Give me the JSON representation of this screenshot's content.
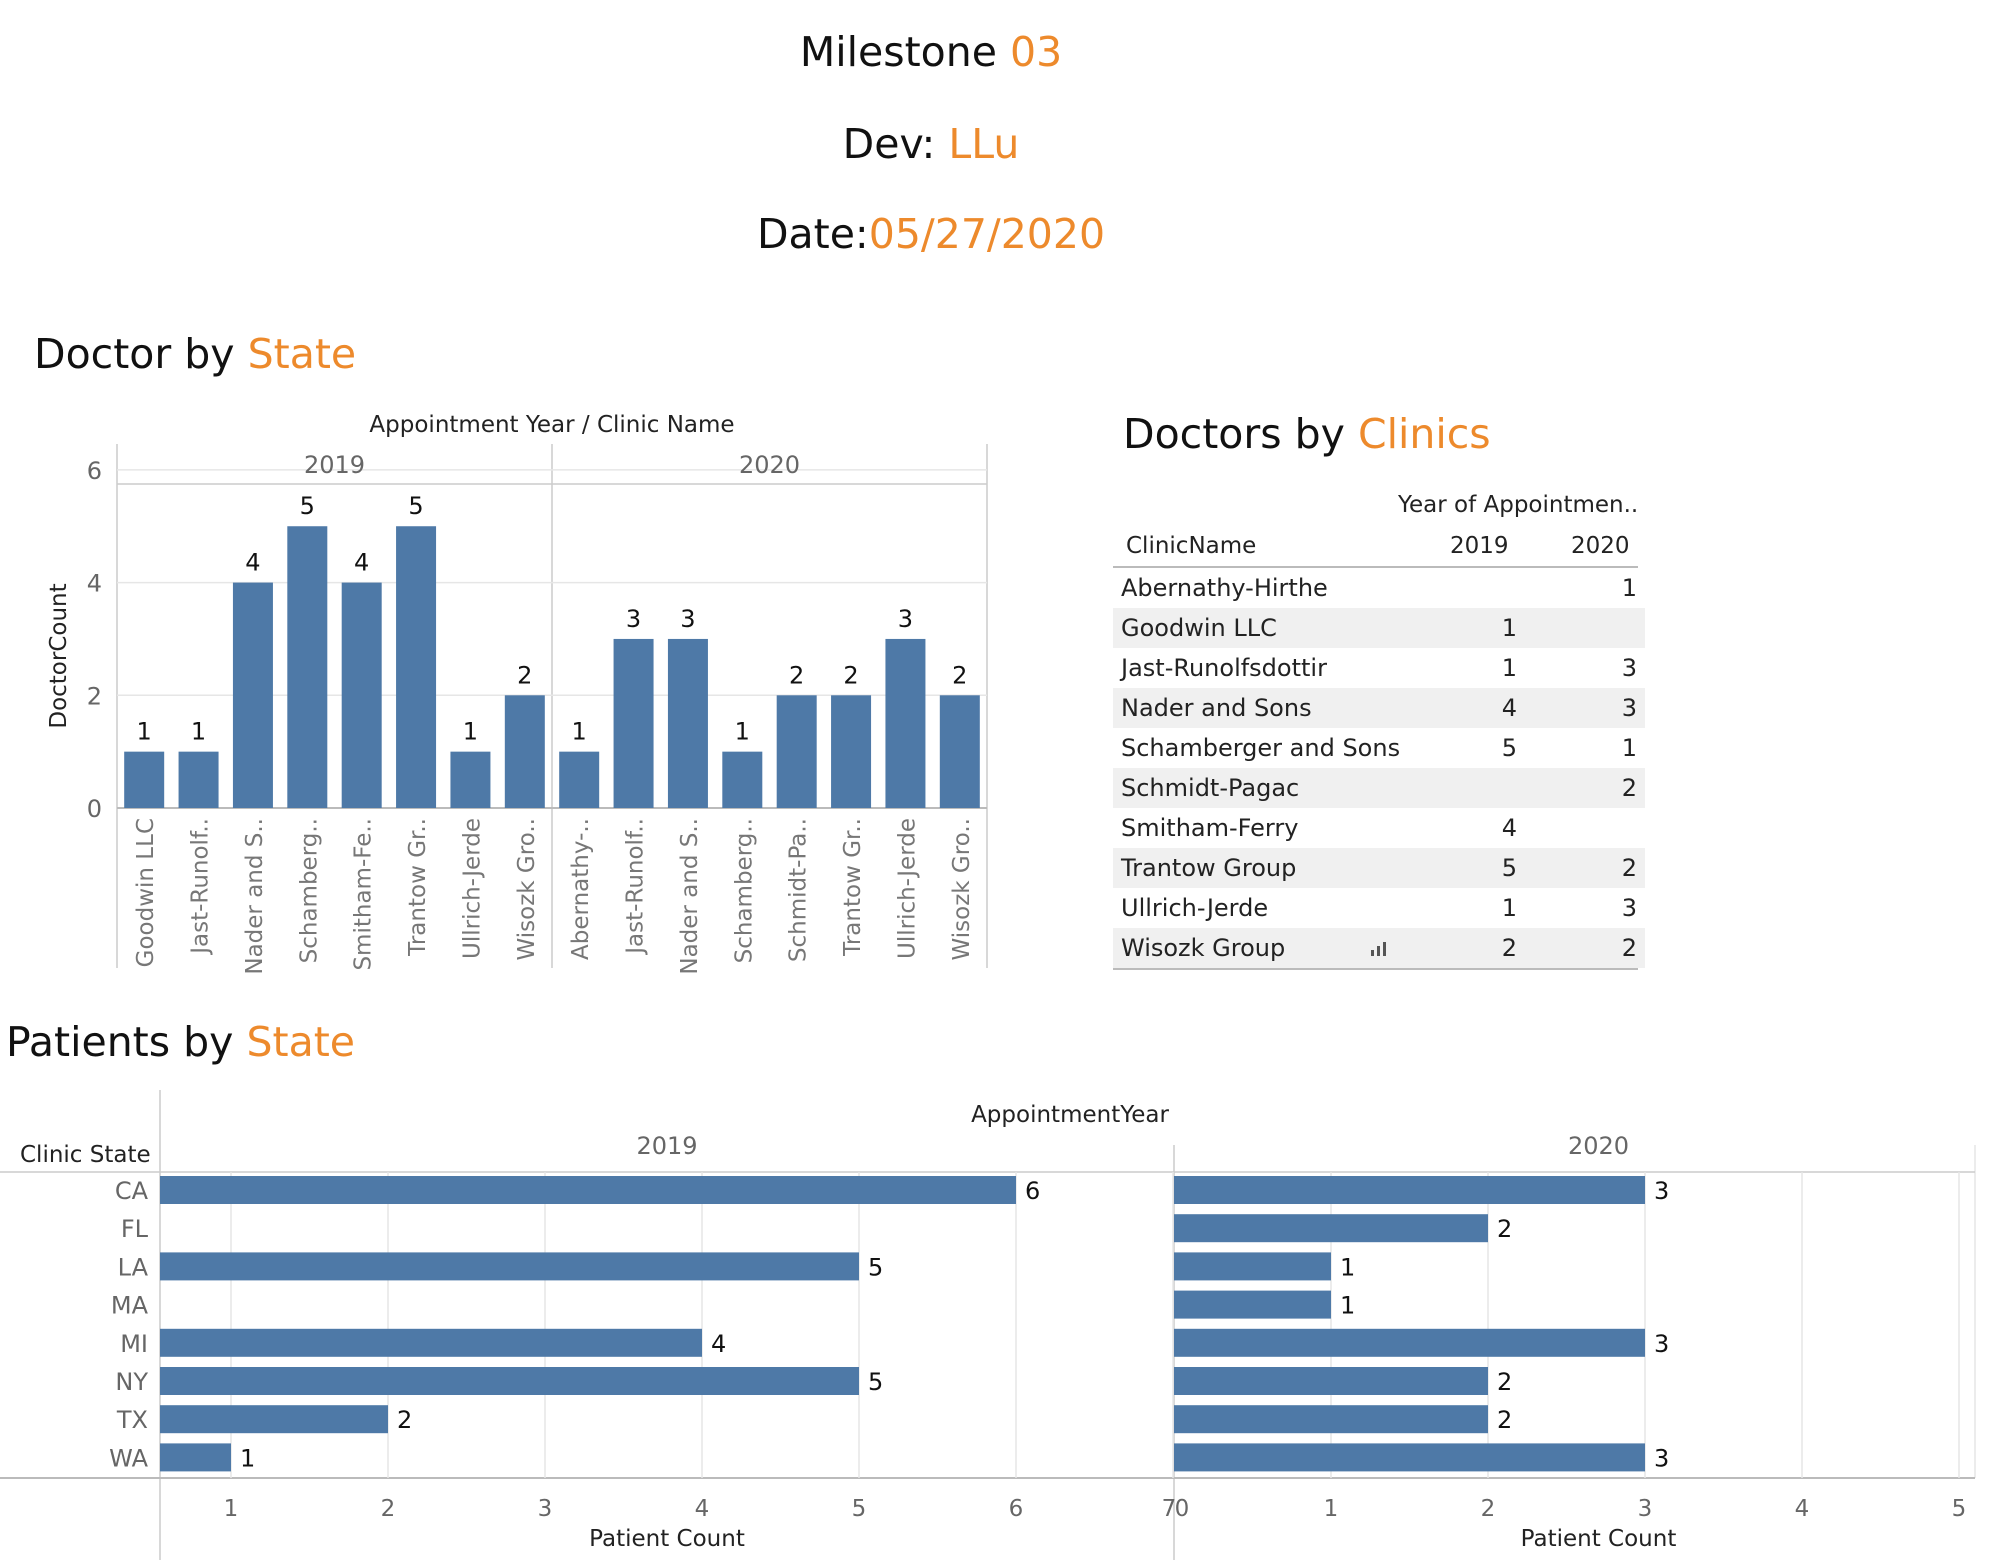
{
  "header": {
    "milestone_label": "Milestone",
    "milestone_value": "03",
    "dev_label": "Dev:",
    "dev_value": "LLu",
    "date_label": "Date:",
    "date_value": "05/27/2020"
  },
  "colors": {
    "accent": "#ed8a2c",
    "bar": "#4e79a7",
    "grid": "#e6e6e6",
    "axis": "#cccccc"
  },
  "doctor_by_state": {
    "title_prefix": "Doctor by",
    "title_highlight": "State",
    "header_label": "Appointment Year  /  Clinic Name",
    "ylabel": "DoctorCount"
  },
  "doctors_by_clinics": {
    "title_prefix": "Doctors by",
    "title_highlight": "Clinics",
    "col_group_label": "Year of Appointmen..",
    "col_clinic": "ClinicName",
    "col_2019": "2019",
    "col_2020": "2020",
    "icon": "bar-chart-icon",
    "rows": [
      {
        "clinic": "Abernathy-Hirthe",
        "y2019": "",
        "y2020": "1"
      },
      {
        "clinic": "Goodwin LLC",
        "y2019": "1",
        "y2020": ""
      },
      {
        "clinic": "Jast-Runolfsdottir",
        "y2019": "1",
        "y2020": "3"
      },
      {
        "clinic": "Nader and Sons",
        "y2019": "4",
        "y2020": "3"
      },
      {
        "clinic": "Schamberger and Sons",
        "y2019": "5",
        "y2020": "1"
      },
      {
        "clinic": "Schmidt-Pagac",
        "y2019": "",
        "y2020": "2"
      },
      {
        "clinic": "Smitham-Ferry",
        "y2019": "4",
        "y2020": ""
      },
      {
        "clinic": "Trantow Group",
        "y2019": "5",
        "y2020": "2"
      },
      {
        "clinic": "Ullrich-Jerde",
        "y2019": "1",
        "y2020": "3"
      },
      {
        "clinic": "Wisozk Group",
        "y2019": "2",
        "y2020": "2"
      }
    ]
  },
  "patients_by_state": {
    "title_prefix": "Patients by",
    "title_highlight": "State",
    "header_label": "AppointmentYear",
    "row_header": "Clinic State",
    "xlabel": "Patient Count"
  },
  "chart_data": [
    {
      "type": "bar",
      "title": "Doctor by State",
      "ylabel": "DoctorCount",
      "ylim": [
        0,
        6
      ],
      "yticks": [
        "0",
        "2",
        "4",
        "6"
      ],
      "grid": true,
      "panels": [
        {
          "name": "2019",
          "categories": [
            "Goodwin LLC",
            "Jast-Runolf..",
            "Nader and S..",
            "Schamberg..",
            "Smitham-Fe..",
            "Trantow Gr..",
            "Ullrich-Jerde",
            "Wisozk Gro.."
          ],
          "values": [
            1,
            1,
            4,
            5,
            4,
            5,
            1,
            2
          ]
        },
        {
          "name": "2020",
          "categories": [
            "Abernathy-..",
            "Jast-Runolf..",
            "Nader and S..",
            "Schamberg..",
            "Schmidt-Pa..",
            "Trantow Gr..",
            "Ullrich-Jerde",
            "Wisozk Gro.."
          ],
          "values": [
            1,
            3,
            3,
            1,
            2,
            2,
            3,
            2
          ]
        }
      ]
    },
    {
      "type": "bar",
      "orientation": "horizontal",
      "title": "Patients by State",
      "xlabel": "Patient Count",
      "categories": [
        "CA",
        "FL",
        "LA",
        "MA",
        "MI",
        "NY",
        "TX",
        "WA"
      ],
      "grid": true,
      "panels": [
        {
          "name": "2019",
          "values": [
            6,
            null,
            5,
            null,
            4,
            5,
            2,
            1
          ],
          "xlim": [
            0.5,
            7
          ],
          "xticks": [
            "1",
            "2",
            "3",
            "4",
            "5",
            "6",
            "7"
          ]
        },
        {
          "name": "2020",
          "values": [
            3,
            2,
            1,
            1,
            3,
            2,
            2,
            3
          ],
          "xlim": [
            0,
            5
          ],
          "xticks": [
            "0",
            "1",
            "2",
            "3",
            "4",
            "5"
          ]
        }
      ]
    }
  ]
}
